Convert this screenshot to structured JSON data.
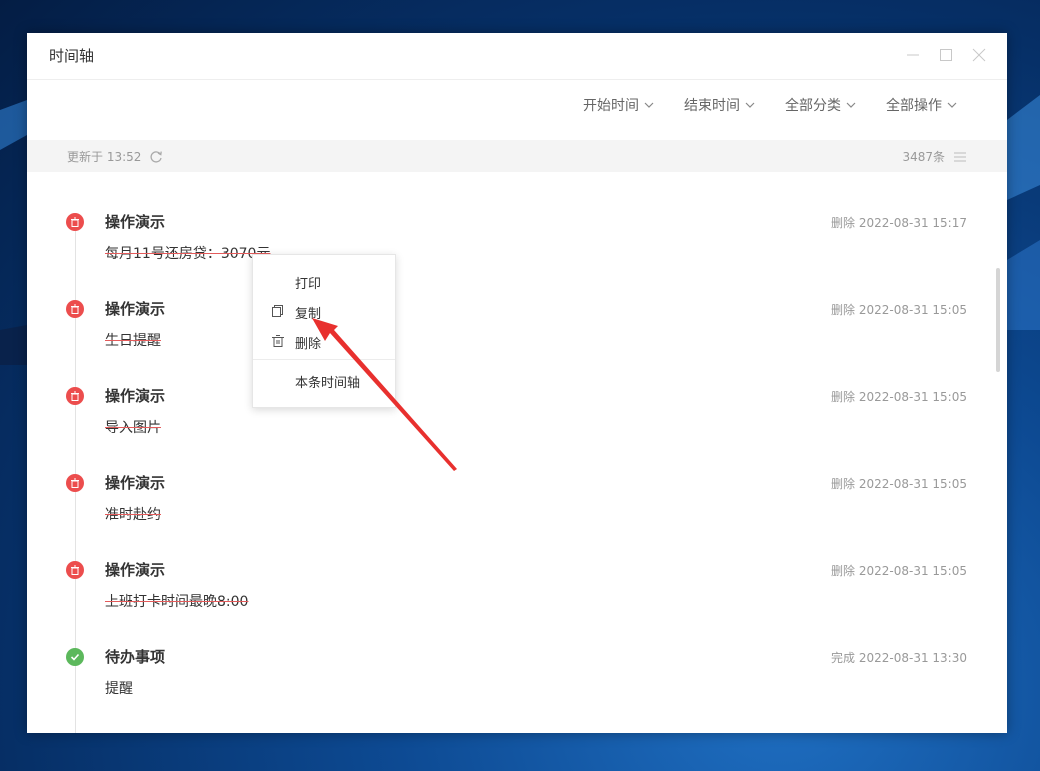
{
  "window": {
    "title": "时间轴"
  },
  "filters": [
    {
      "label": "开始时间"
    },
    {
      "label": "结束时间"
    },
    {
      "label": "全部分类"
    },
    {
      "label": "全部操作"
    }
  ],
  "status": {
    "updated": "更新于 13:52",
    "count": "3487条"
  },
  "items": [
    {
      "title": "操作演示",
      "text": "每月11号还房贷：3070元",
      "meta": "删除 2022-08-31 15:17",
      "kind": "delete"
    },
    {
      "title": "操作演示",
      "text": "生日提醒",
      "meta": "删除 2022-08-31 15:05",
      "kind": "delete"
    },
    {
      "title": "操作演示",
      "text": "导入图片",
      "meta": "删除 2022-08-31 15:05",
      "kind": "delete"
    },
    {
      "title": "操作演示",
      "text": "准时赴约",
      "meta": "删除 2022-08-31 15:05",
      "kind": "delete"
    },
    {
      "title": "操作演示",
      "text": "上班打卡时间最晚8:00",
      "meta": "删除 2022-08-31 15:05",
      "kind": "delete"
    },
    {
      "title": "待办事项",
      "text": "提醒",
      "meta": "完成 2022-08-31 13:30",
      "kind": "done"
    }
  ],
  "context_menu": {
    "items": [
      {
        "label": "打印",
        "icon": ""
      },
      {
        "label": "复制",
        "icon": "copy-icon"
      },
      {
        "label": "删除",
        "icon": "trash-icon"
      },
      {
        "label": "本条时间轴",
        "icon": ""
      }
    ]
  },
  "colors": {
    "delete": "#ec4d4d",
    "done": "#5cb85c",
    "annotation_arrow": "#e8302e"
  }
}
